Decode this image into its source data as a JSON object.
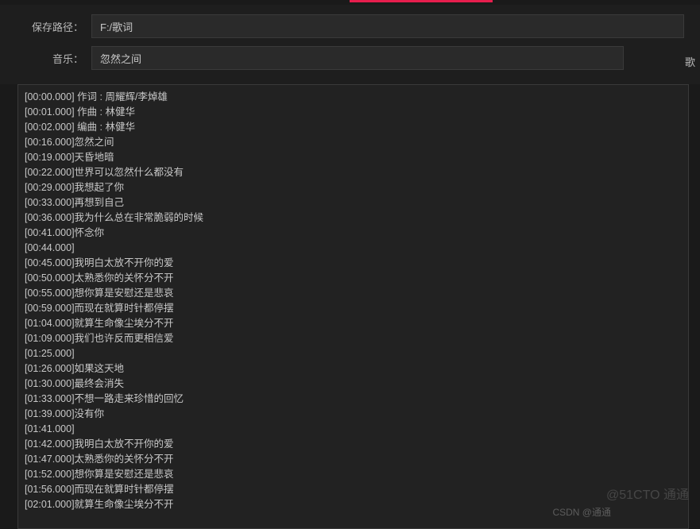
{
  "form": {
    "save_path_label": "保存路径：",
    "save_path_value": "F:/歌词",
    "music_label": "音乐：",
    "music_value": "忽然之间",
    "side_label": "歌"
  },
  "lyrics": [
    "[00:00.000] 作词 : 周耀辉/李焯雄",
    "[00:01.000] 作曲 : 林健华",
    "[00:02.000] 编曲 : 林健华",
    "[00:16.000]忽然之间",
    "[00:19.000]天昏地暗",
    "[00:22.000]世界可以忽然什么都没有",
    "[00:29.000]我想起了你",
    "[00:33.000]再想到自己",
    "[00:36.000]我为什么总在非常脆弱的时候",
    "[00:41.000]怀念你",
    "[00:44.000]",
    "[00:45.000]我明白太放不开你的爱",
    "[00:50.000]太熟悉你的关怀分不开",
    "[00:55.000]想你算是安慰还是悲哀",
    "[00:59.000]而现在就算时针都停摆",
    "[01:04.000]就算生命像尘埃分不开",
    "[01:09.000]我们也许反而更相信爱",
    "[01:25.000]",
    "[01:26.000]如果这天地",
    "[01:30.000]最终会消失",
    "[01:33.000]不想一路走来珍惜的回忆",
    "[01:39.000]没有你",
    "[01:41.000]",
    "[01:42.000]我明白太放不开你的爱",
    "[01:47.000]太熟悉你的关怀分不开",
    "[01:52.000]想你算是安慰还是悲哀",
    "[01:56.000]而现在就算时针都停摆",
    "[02:01.000]就算生命像尘埃分不开"
  ],
  "watermark": {
    "brand": "@51CTO 通通",
    "csdn": "CSDN @通通"
  }
}
